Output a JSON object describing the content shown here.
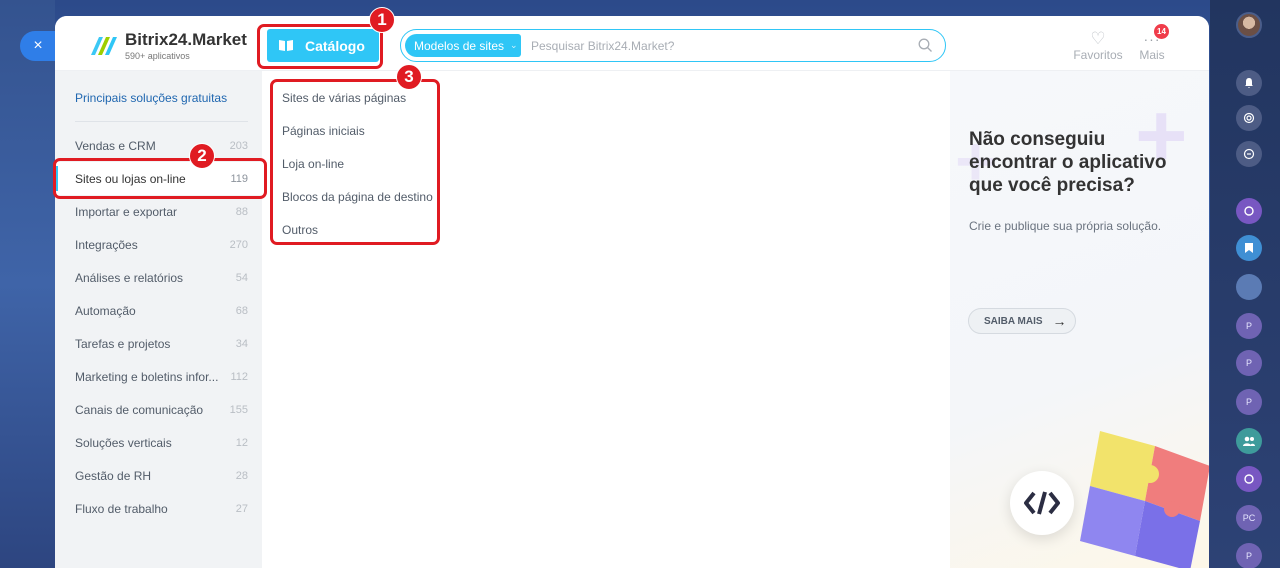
{
  "colors": {
    "accent": "#2fc6f6",
    "annotation": "#e01b22",
    "link": "#2067b0"
  },
  "close_label": "×",
  "header": {
    "title": "Bitrix24.Market",
    "subtitle": "590+ aplicativos",
    "catalog_label": "Catálogo",
    "search_select_label": "Modelos de sites",
    "search_placeholder": "Pesquisar Bitrix24.Market?",
    "favorites_label": "Favoritos",
    "more_label": "Mais",
    "more_badge": "14"
  },
  "sidebar": {
    "top_link": "Principais soluções gratuitas",
    "items": [
      {
        "label": "Vendas e CRM",
        "count": "203"
      },
      {
        "label": "Sites ou lojas on-line",
        "count": "119"
      },
      {
        "label": "Importar e exportar",
        "count": "88"
      },
      {
        "label": "Integrações",
        "count": "270"
      },
      {
        "label": "Análises e relatórios",
        "count": "54"
      },
      {
        "label": "Automação",
        "count": "68"
      },
      {
        "label": "Tarefas e projetos",
        "count": "34"
      },
      {
        "label": "Marketing e boletins infor...",
        "count": "112"
      },
      {
        "label": "Canais de comunicação",
        "count": "155"
      },
      {
        "label": "Soluções verticais",
        "count": "12"
      },
      {
        "label": "Gestão de RH",
        "count": "28"
      },
      {
        "label": "Fluxo de trabalho",
        "count": "27"
      }
    ]
  },
  "submenu": {
    "items": [
      "Sites de várias páginas",
      "Páginas iniciais",
      "Loja on-line",
      "Blocos da página de destino",
      "Outros"
    ]
  },
  "promo": {
    "title": "Não conseguiu encontrar o aplicativo que você precisa?",
    "text": "Crie e publique sua própria solução.",
    "button_label": "SAIBA MAIS"
  },
  "annotations": {
    "n1": "1",
    "n2": "2",
    "n3": "3"
  },
  "rail": {
    "pc_label": "PC",
    "p_label": "P"
  }
}
